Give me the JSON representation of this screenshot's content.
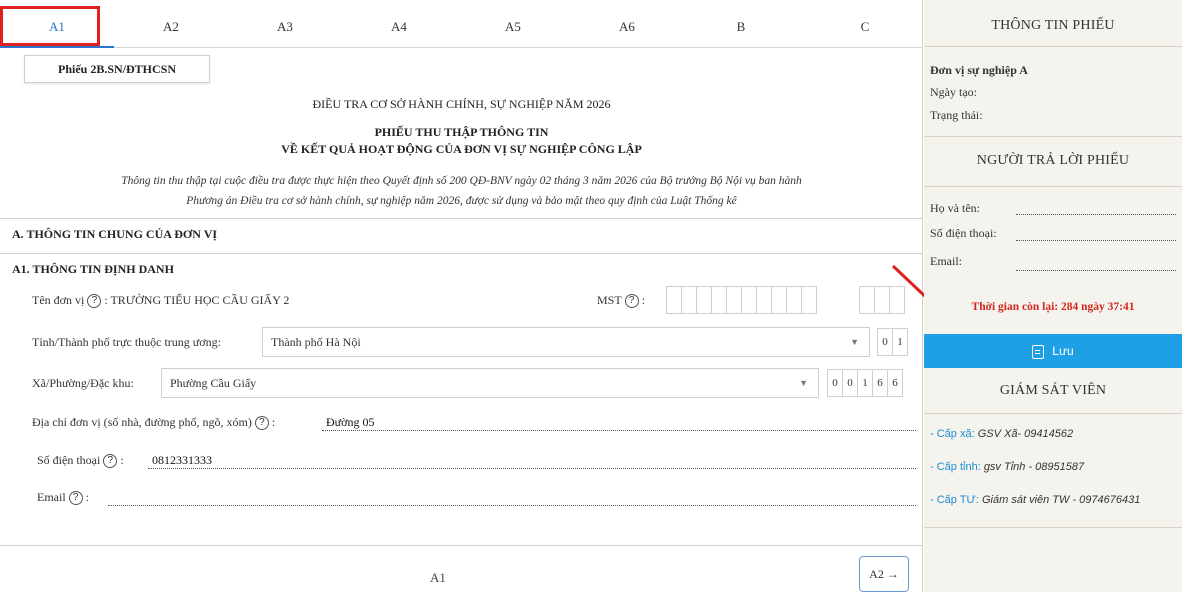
{
  "tabs": [
    "A1",
    "A2",
    "A3",
    "A4",
    "A5",
    "A6",
    "B",
    "C"
  ],
  "active_tab": "A1",
  "form_code": "Phiếu 2B.SN/ĐTHCSN",
  "header": {
    "survey": "ĐIỀU TRA CƠ SỞ HÀNH CHÍNH, SỰ NGHIỆP NĂM 2026",
    "title_line1": "PHIẾU THU THẬP THÔNG TIN",
    "title_line2": "VỀ KẾT QUẢ HOẠT ĐỘNG CỦA ĐƠN VỊ SỰ NGHIỆP CÔNG LẬP",
    "note_line1": "Thông tin thu thập tại cuộc điều tra được thực hiện theo Quyết định số 200 QĐ-BNV ngày 02 tháng 3 năm 2026 của Bộ trưởng Bộ Nội vụ ban hành",
    "note_line2": "Phương án Điều tra cơ sở hành chính, sự nghiệp năm 2026, được sử dụng và bảo mật theo quy định của Luật Thống kê"
  },
  "sections": {
    "a": "A. THÔNG TIN CHUNG CỦA ĐƠN VỊ",
    "a1": "A1. THÔNG TIN ĐỊNH DANH"
  },
  "fields": {
    "unit_name_label": "Tên đơn vị",
    "unit_name_value": ": TRƯỜNG TIỂU HỌC CẦU GIẤY 2",
    "mst_label": "MST",
    "province_label": "Tỉnh/Thành phố trực thuộc trung ương:",
    "province_value": "Thành phố Hà Nội",
    "province_code": [
      "0",
      "1"
    ],
    "ward_label": "Xã/Phường/Đặc khu:",
    "ward_value": "Phường Cầu Giấy",
    "ward_code": [
      "0",
      "0",
      "1",
      "6",
      "6"
    ],
    "address_label": "Địa chỉ đơn vị (số nhà, đường phố, ngõ, xóm)",
    "address_value": "Đường 05",
    "phone_label": "Số điện thoại",
    "phone_value": "0812331333",
    "email_label": "Email",
    "email_value": ""
  },
  "help_icon": "?",
  "footer": {
    "page": "A1",
    "next_label": "A2 →"
  },
  "sidebar": {
    "info_title": "THÔNG TIN PHIẾU",
    "unit": "Đơn vị sự nghiệp A",
    "created_label": "Ngày tạo:",
    "status_label": "Trạng thái:",
    "respondent_title": "NGƯỜI TRẢ LỜI PHIẾU",
    "name_label": "Họ và tên:",
    "phone_label": "Số điện thoại:",
    "email_label": "Email:",
    "timer": "Thời gian còn lại: 284 ngày 37:41",
    "save_label": "Lưu",
    "supervisor_title": "GIÁM SÁT VIÊN",
    "supervisors": [
      {
        "level": "- Cấp xã:",
        "name": "GSV Xã- 09414562"
      },
      {
        "level": "- Cấp tỉnh:",
        "name": "gsv Tỉnh - 08951587"
      },
      {
        "level": "- Cấp TƯ:",
        "name": "Giám sát viên TW - 0974676431"
      }
    ]
  },
  "colors": {
    "accent": "#2a74c9",
    "highlight": "#e02020",
    "save": "#1fa0e4",
    "timer": "#d3261c"
  }
}
